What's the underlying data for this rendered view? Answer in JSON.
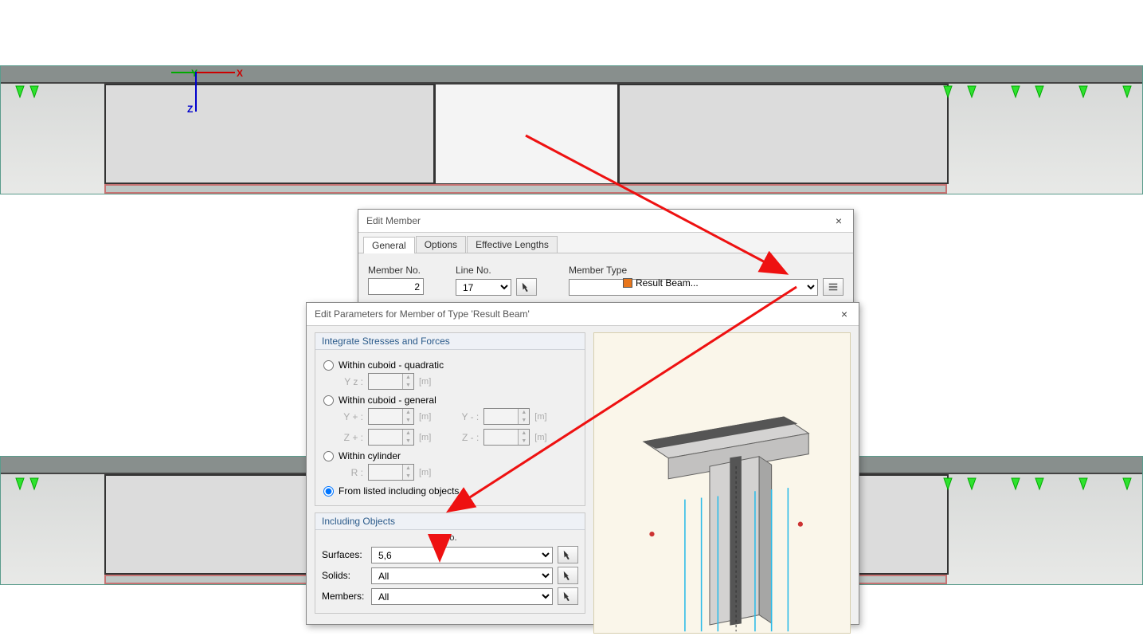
{
  "dialog_edit_member": {
    "title": "Edit Member",
    "tabs": [
      "General",
      "Options",
      "Effective Lengths"
    ],
    "active_tab": 0,
    "fields": {
      "member_no_label": "Member No.",
      "member_no": "2",
      "line_no_label": "Line No.",
      "line_no": "17",
      "member_type_label": "Member Type",
      "member_type": "Result Beam..."
    }
  },
  "dialog_params": {
    "title": "Edit Parameters for Member of Type 'Result Beam'",
    "group_integrate": "Integrate Stresses and Forces",
    "radios": {
      "quadratic": "Within cuboid - quadratic",
      "general": "Within cuboid - general",
      "cylinder": "Within cylinder",
      "from_listed": "From listed including objects"
    },
    "selected_radio": "from_listed",
    "sub": {
      "Yz": "Y z :",
      "Y_plus": "Y + :",
      "Z_plus": "Z + :",
      "Y_minus": "Y - :",
      "Z_minus": "Z - :",
      "R": "R :",
      "unit_m": "[m]"
    },
    "group_objects": "Including Objects",
    "objects": {
      "no_header": "No.",
      "surfaces_label": "Surfaces:",
      "surfaces_value": "5,6",
      "solids_label": "Solids:",
      "solids_value": "All",
      "members_label": "Members:",
      "members_value": "All"
    }
  },
  "icons": {
    "close": "×",
    "pick": "pick-icon",
    "settings": "settings-icon"
  },
  "colors": {
    "arrow": "#e11",
    "support": "#2ee22e",
    "dialog_accent": "#2a5a8a"
  }
}
